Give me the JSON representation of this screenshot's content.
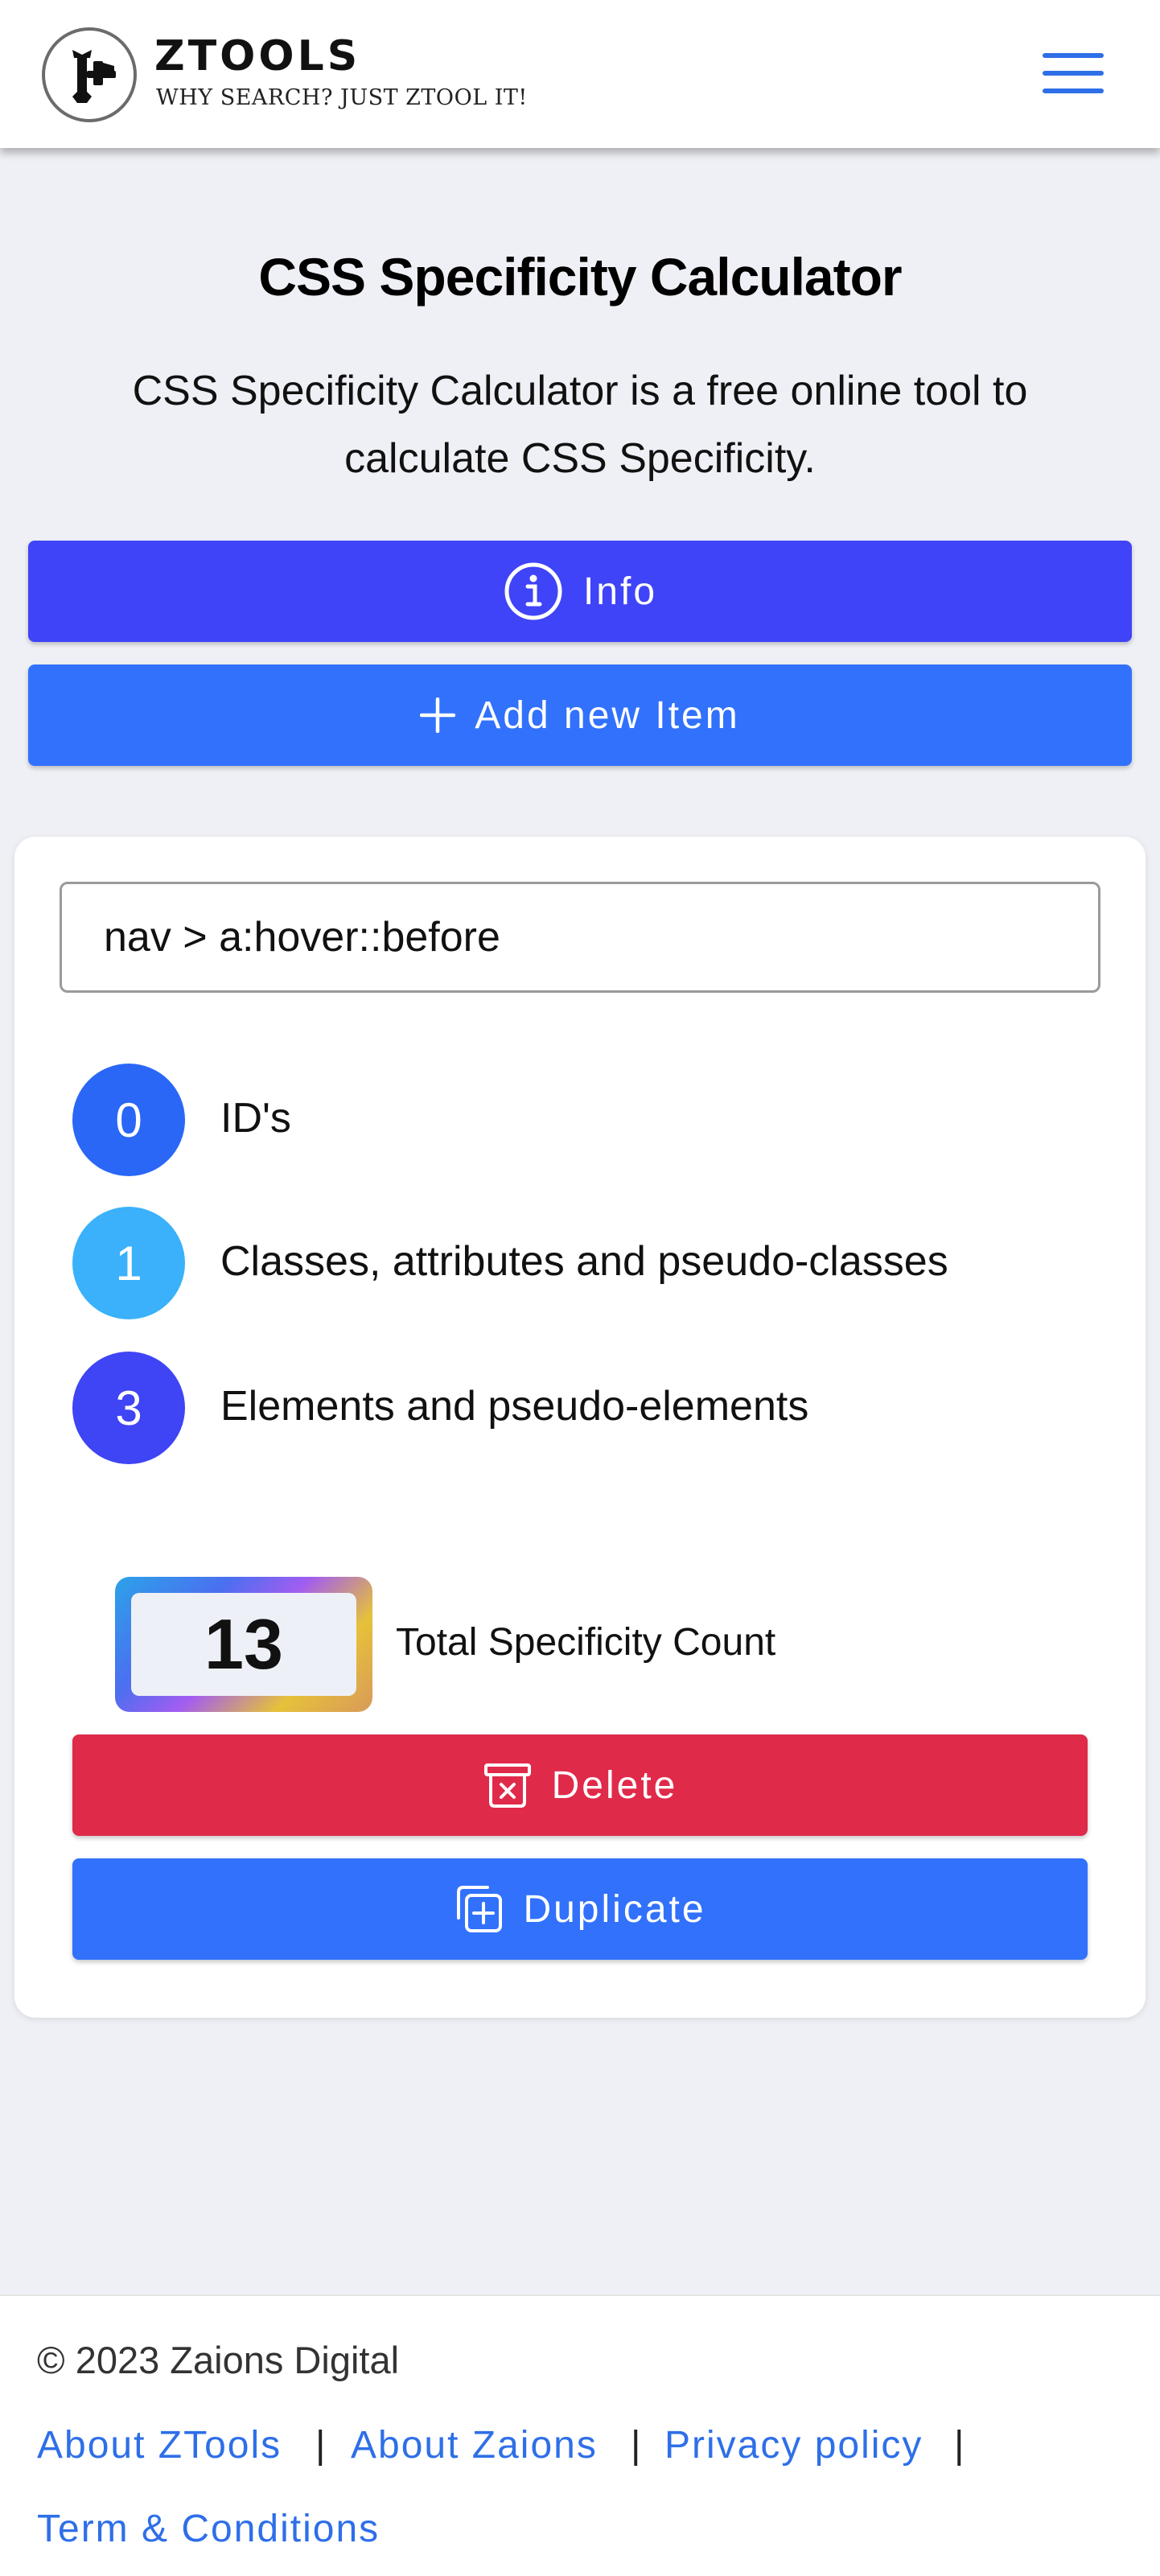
{
  "header": {
    "brand_name": "ZTOOLS",
    "brand_tagline": "WHY SEARCH? JUST ZTOOL IT!",
    "logo_icon": "hammer-wrench-icon",
    "menu_icon": "hamburger-menu-icon"
  },
  "intro": {
    "title": "CSS Specificity Calculator",
    "description": "CSS Specificity Calculator is a free online tool to calculate CSS Specificity."
  },
  "actions": {
    "info_label": "Info",
    "info_icon": "info-circle-icon",
    "add_label": "Add new Item",
    "add_icon": "plus-icon"
  },
  "item": {
    "selector_value": "nav > a:hover::before",
    "specificity": [
      {
        "count": "0",
        "label": "ID's",
        "color": "#2a67f6"
      },
      {
        "count": "1",
        "label": "Classes, attributes and pseudo-classes",
        "color": "#3ab1fa"
      },
      {
        "count": "3",
        "label": "Elements and pseudo-elements",
        "color": "#3f44f4"
      }
    ],
    "total_value": "13",
    "total_label": "Total Specificity Count",
    "delete_label": "Delete",
    "delete_icon": "trash-x-icon",
    "duplicate_label": "Duplicate",
    "duplicate_icon": "copy-plus-icon"
  },
  "footer": {
    "copyright": "© 2023 Zaions Digital",
    "links": [
      "About ZTools",
      "About Zaions",
      "Privacy policy",
      "Term & Conditions"
    ],
    "separator": "|"
  },
  "colors": {
    "info_button": "#3f44f8",
    "primary_button": "#3171fc",
    "delete_button": "#e02a4a",
    "link": "#2e6fe8",
    "page_background": "#eff0f5"
  }
}
